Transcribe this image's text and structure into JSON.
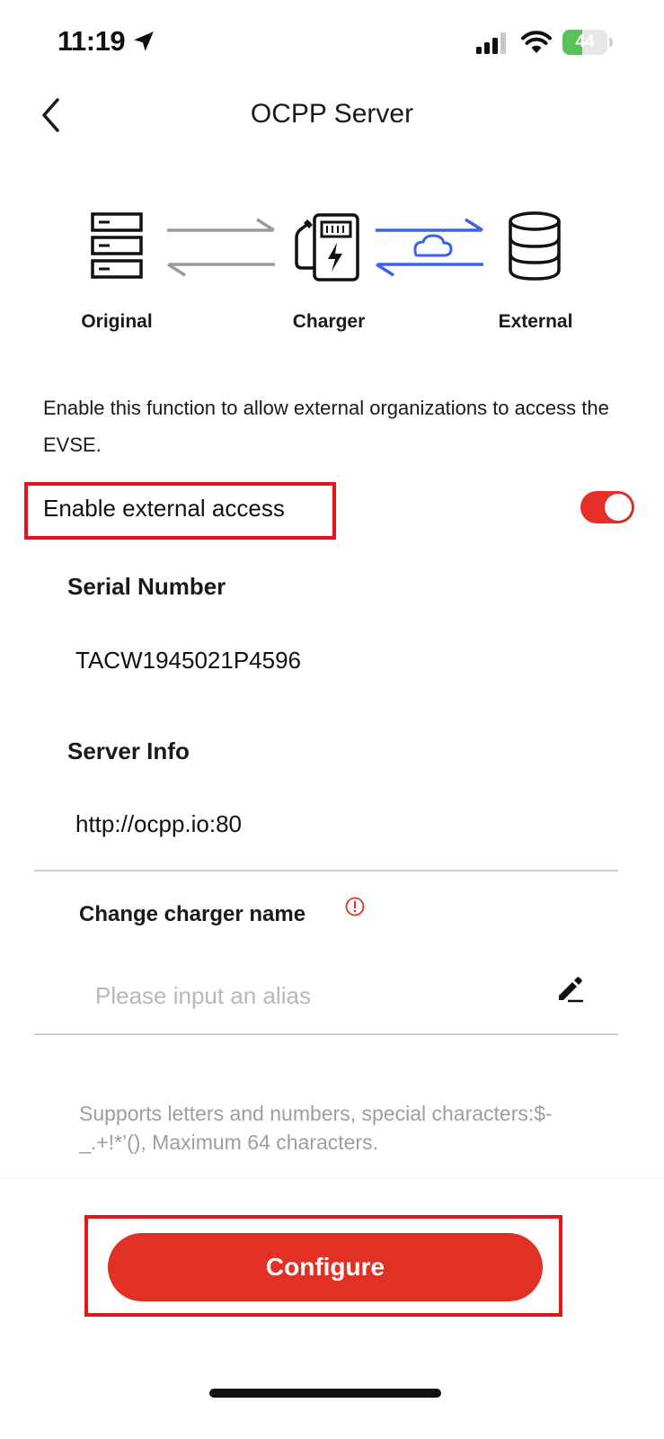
{
  "status_bar": {
    "time": "11:19",
    "battery_level": "44",
    "battery_fraction": 0.44,
    "icons": [
      "location-arrow-icon",
      "cellular-signal-icon",
      "wifi-icon",
      "battery-charging-icon"
    ]
  },
  "nav": {
    "title": "OCPP Server",
    "back_icon": "chevron-left-icon"
  },
  "diagram": {
    "original_label": "Original",
    "charger_label": "Charger",
    "external_label": "External",
    "icons": [
      "server-rack-icon",
      "bidirectional-arrows-icon",
      "ev-charger-icon",
      "cloud-arrows-icon",
      "database-icon"
    ],
    "colors": {
      "neutral_arrows": "#9a9a9a",
      "cloud_arrows": "#3b63e6"
    }
  },
  "description": "Enable this function to allow external organizations to access the EVSE.",
  "external_access": {
    "label": "Enable external access",
    "enabled": true
  },
  "serial": {
    "heading": "Serial Number",
    "value": "TACW1945021P4596"
  },
  "server": {
    "heading": "Server Info",
    "value": "http://ocpp.io:80"
  },
  "alias": {
    "heading": "Change charger name",
    "placeholder": "Please input an alias",
    "value": "",
    "hint": "Supports letters and numbers, special characters:$-_.+!*’(), Maximum 64 characters."
  },
  "footer": {
    "configure_label": "Configure"
  },
  "colors": {
    "accent": "#e33025",
    "highlight_box": "#e8141c",
    "hint_text": "#9d9da3",
    "divider": "#c9cbd8"
  }
}
